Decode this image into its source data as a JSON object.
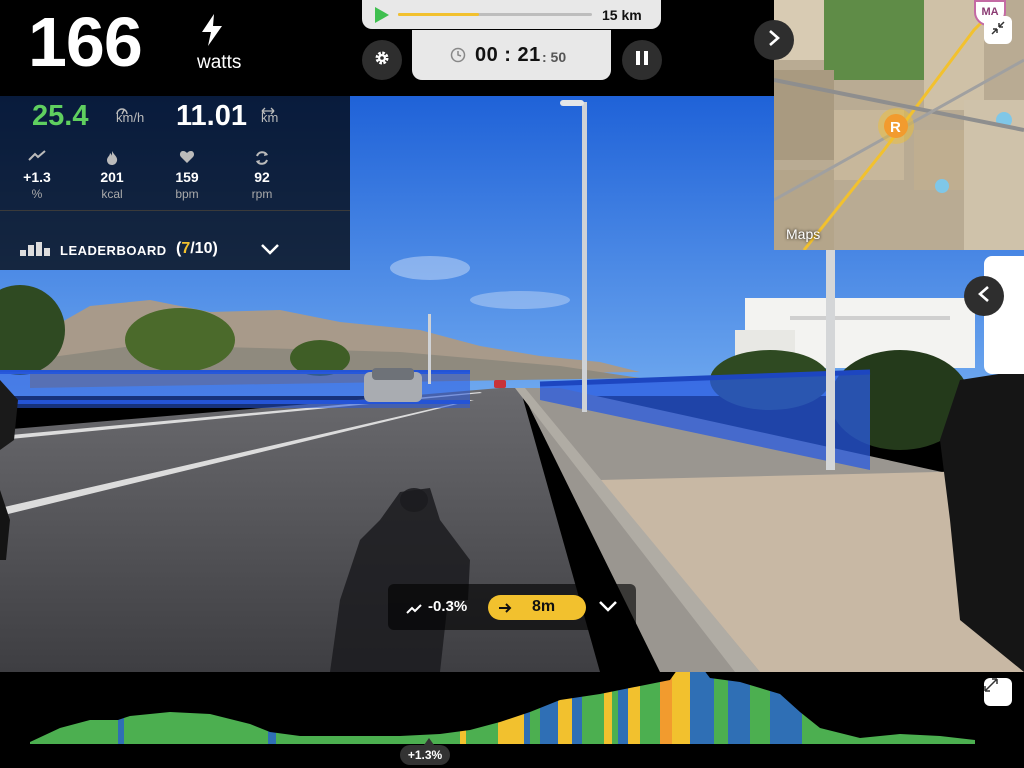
{
  "header": {
    "power_value": "166",
    "power_unit": "watts",
    "power_icon": "lightning-icon"
  },
  "route": {
    "progress": 0.42,
    "distance_label": "15 km",
    "accent": "#f2c12e"
  },
  "timer": {
    "main": "00 : 21",
    "seconds": ": 50"
  },
  "stats": {
    "speed_value": "25.4",
    "speed_unit": "km/h",
    "distance_value": "11.01",
    "distance_unit": "km",
    "metrics": [
      {
        "name": "slope",
        "icon": "slope-icon",
        "value": "+1.3",
        "unit": "%"
      },
      {
        "name": "calories",
        "icon": "flame-icon",
        "value": "201",
        "unit": "kcal"
      },
      {
        "name": "heart-rate",
        "icon": "heart-icon",
        "value": "159",
        "unit": "bpm"
      },
      {
        "name": "cadence",
        "icon": "cycle-icon",
        "value": "92",
        "unit": "rpm"
      }
    ]
  },
  "leaderboard": {
    "label": "LEADERBOARD",
    "open": "(",
    "current": "7",
    "total": "/10)"
  },
  "map": {
    "label": "Maps",
    "avatar_initials": "MA"
  },
  "slope_pill": {
    "value": "-0.3%",
    "next_distance": "8m"
  },
  "elevation": {
    "current_grade": "+1.3%",
    "colors": {
      "green": "#4caf50",
      "blue": "#2f6fb5",
      "yellow": "#f2c12e",
      "orange": "#f29b2e"
    }
  }
}
